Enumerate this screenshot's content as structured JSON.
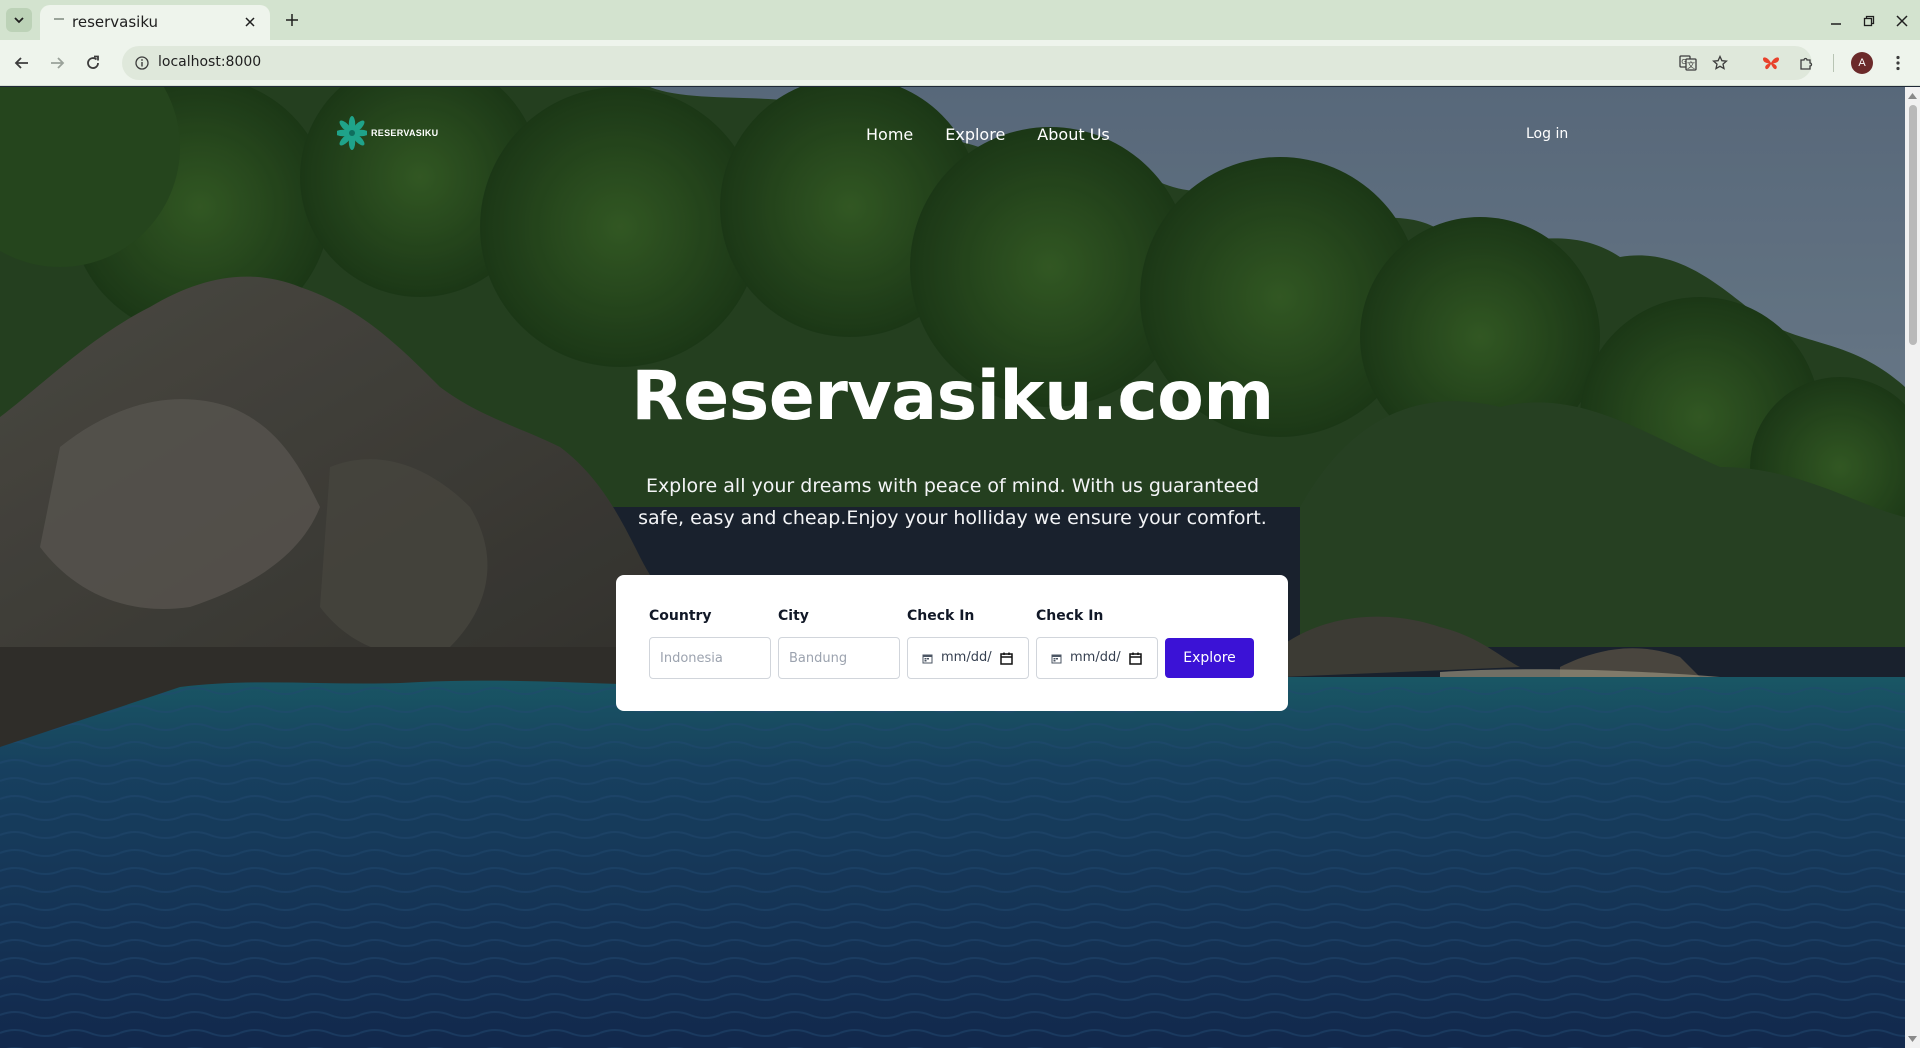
{
  "browser": {
    "tab_title": "reservasiku",
    "url": "localhost:8000",
    "avatar_letter": "A"
  },
  "site": {
    "logo_text": "RESERVASIKU",
    "nav": [
      {
        "label": "Home"
      },
      {
        "label": "Explore"
      },
      {
        "label": "About Us"
      }
    ],
    "login_label": "Log in"
  },
  "hero": {
    "title": "Reservasiku.com",
    "subtitle": "Explore all your dreams with peace of mind. With us guaranteed safe, easy and cheap.Enjoy your holliday we ensure your comfort."
  },
  "search": {
    "country": {
      "label": "Country",
      "placeholder": "Indonesia"
    },
    "city": {
      "label": "City",
      "placeholder": "Bandung"
    },
    "check_in_1": {
      "label": "Check In",
      "placeholder": "mm/dd/yyyy"
    },
    "check_in_2": {
      "label": "Check In",
      "placeholder": "mm/dd/yyyy"
    },
    "submit_label": "Explore"
  },
  "colors": {
    "tabbar": "#d3e3cf",
    "toolbar": "#eef4ec",
    "accent_button": "#3b12d6",
    "card": "#ffffff"
  }
}
